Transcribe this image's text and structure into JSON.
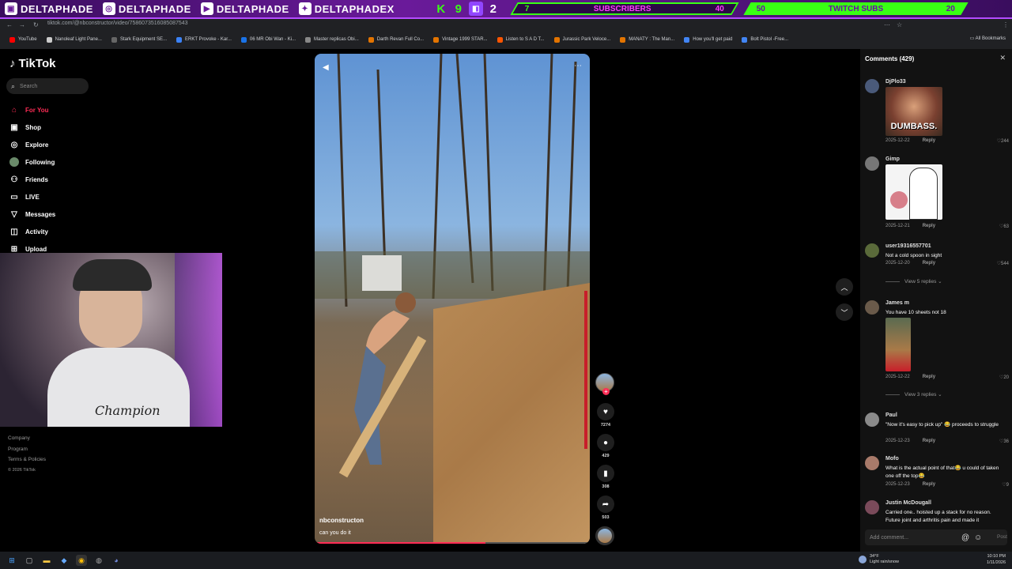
{
  "banner": {
    "socials": [
      "DELTAPHADE",
      "DELTAPHADE",
      "DELTAPHADE",
      "DELTAPHADEX"
    ],
    "kick_count": [
      "K",
      "9",
      "2"
    ],
    "subs_goal": {
      "current": "7",
      "label": "SUBSCRIBERS",
      "target": "40"
    },
    "twitch_goal": {
      "current": "50",
      "label": "TWITCH SUBS",
      "target": "20"
    },
    "accent": "#39ff14"
  },
  "browser": {
    "url": "tiktok.com/@nbconstructor/video/7586073516085087543",
    "bookmarks": [
      "YouTube",
      "Nanoleaf Light Pane...",
      "Stark Equipment SE...",
      "ERKT Provoke - Kar...",
      "06 MR Obi Wan - Ki...",
      "Master replicas Obi...",
      "Darth Revan Full Co...",
      "Vintage 1999 STAR...",
      "Listen to S A D T...",
      "Jurassic Park Veloce...",
      "MANATY : The Man...",
      "How you'll get paid",
      "Bolt Pistol -Free..."
    ],
    "all_bookmarks": "All Bookmarks"
  },
  "sidebar": {
    "logo": "TikTok",
    "search_placeholder": "Search",
    "items": [
      {
        "label": "For You",
        "icon": "home-icon",
        "active": true
      },
      {
        "label": "Shop",
        "icon": "bag-icon"
      },
      {
        "label": "Explore",
        "icon": "compass-icon"
      },
      {
        "label": "Following",
        "icon": "following-icon"
      },
      {
        "label": "Friends",
        "icon": "friends-icon"
      },
      {
        "label": "LIVE",
        "icon": "live-icon"
      },
      {
        "label": "Messages",
        "icon": "messages-icon"
      },
      {
        "label": "Activity",
        "icon": "activity-icon"
      },
      {
        "label": "Upload",
        "icon": "upload-icon"
      }
    ],
    "footer": {
      "company": "Company",
      "program": "Program",
      "terms": "Terms & Policies",
      "copyright": "© 2026 TikTok"
    }
  },
  "webcam": {
    "shirt_text": "Champion"
  },
  "video": {
    "username": "nbconstructon",
    "caption": "can you do it",
    "progress": 0.62,
    "likes": "7274",
    "comments": "429",
    "saves": "308",
    "shares": "503"
  },
  "comments": {
    "header": "Comments (429)",
    "add_placeholder": "Add comment...",
    "post_label": "Post",
    "items": [
      {
        "user": "DjPlo33",
        "text": "",
        "image_text": "DUMBASS.",
        "date": "2025-12-22",
        "reply": "Reply",
        "likes": "244"
      },
      {
        "user": "Gimp",
        "text": "",
        "date": "2025-12-21",
        "reply": "Reply",
        "likes": "63"
      },
      {
        "user": "user19316557701",
        "text": "Not a cold spoon in sight",
        "date": "2025-12-20",
        "reply": "Reply",
        "likes": "544",
        "view_replies": "View 5 replies"
      },
      {
        "user": "James m",
        "text": "You have 10 sheets not 18",
        "date": "2025-12-22",
        "reply": "Reply",
        "likes": "20",
        "view_replies": "View 3 replies"
      },
      {
        "user": "Paul",
        "text": "\"Now it's easy to pick up\" 😂 proceeds to struggle",
        "date": "2025-12-23",
        "reply": "Reply",
        "likes": "36"
      },
      {
        "user": "Mofo",
        "text": "What is the actual point of that😂 u could of taken one off the top😂",
        "date": "2025-12-23",
        "reply": "Reply",
        "likes": "9"
      },
      {
        "user": "Justin McDougall",
        "text": "Carried one.. hoisted up a stack for no reason. Future joint and arthritis pain and made it",
        "date": "",
        "reply": "",
        "likes": ""
      }
    ]
  },
  "taskbar": {
    "weather_temp": "34°F",
    "weather_desc": "Light rain/snow",
    "time": "10:10 PM",
    "date": "1/11/2026"
  }
}
